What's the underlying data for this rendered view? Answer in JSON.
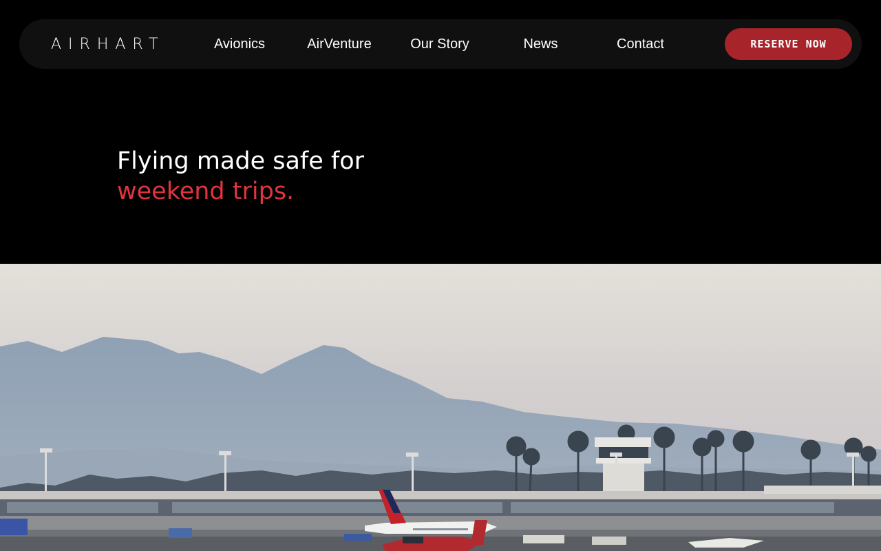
{
  "brand": {
    "logo_text": "AIRHART"
  },
  "nav": {
    "links": [
      {
        "label": "Avionics"
      },
      {
        "label": "AirVenture"
      },
      {
        "label": "Our Story"
      },
      {
        "label": "News"
      },
      {
        "label": "Contact"
      }
    ],
    "cta_label": "RESERVE NOW"
  },
  "hero": {
    "headline_line1": "Flying made safe for",
    "headline_line2": "weekend trips."
  },
  "colors": {
    "background": "#000000",
    "nav_background": "#101010",
    "cta": "#a8242b",
    "accent_text": "#e0353d"
  }
}
